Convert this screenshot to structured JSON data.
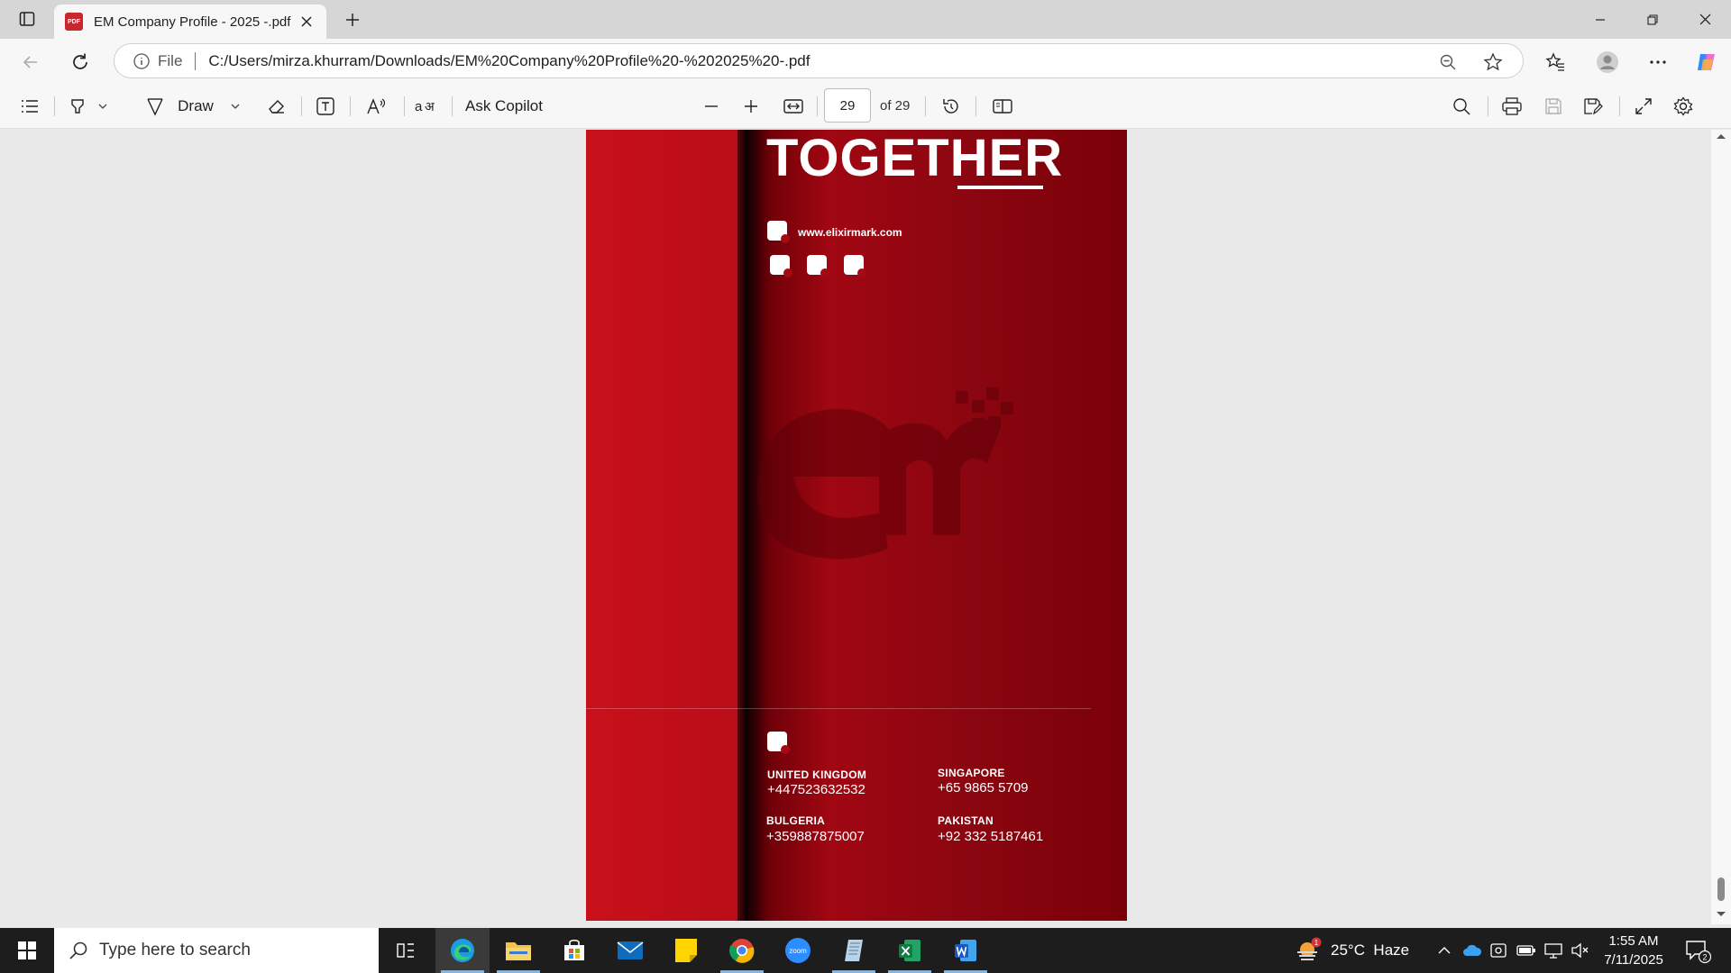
{
  "browser": {
    "tab_title": "EM Company Profile - 2025 -.pdf",
    "file_label": "File",
    "url": "C:/Users/mirza.khurram/Downloads/EM%20Company%20Profile%20-%202025%20-.pdf"
  },
  "pdf_toolbar": {
    "draw_label": "Draw",
    "ask_copilot_label": "Ask Copilot",
    "page_current": "29",
    "page_total": "of 29"
  },
  "document": {
    "heading": "TOGETHER",
    "website": "www.elixirmark.com",
    "offices": [
      {
        "country": "UNITED KINGDOM",
        "phone": "+447523632532"
      },
      {
        "country": "SINGAPORE",
        "phone": "+65 9865 5709"
      },
      {
        "country": "BULGERIA",
        "phone": "+359887875007"
      },
      {
        "country": "PAKISTAN",
        "phone": "+92 332 5187461"
      }
    ],
    "colors": {
      "primary": "#c8101b",
      "dark": "#7a0008"
    }
  },
  "taskbar": {
    "search_placeholder": "Type here to search",
    "weather": "25°C  Haze",
    "weather_badge": "1",
    "time": "1:55 AM",
    "date": "7/11/2025",
    "notification_count": "2"
  }
}
